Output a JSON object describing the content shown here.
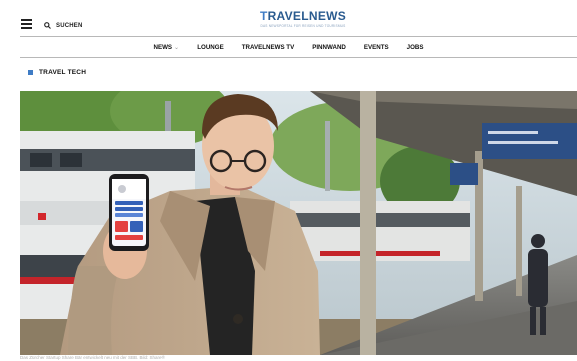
{
  "header": {
    "search_label": "SUCHEN",
    "logo": {
      "name_t": "T",
      "name_rest": "RAVELNEWS",
      "tagline": "DAS NEWSPORTAL FÜR REISEN UND TOURISMUS"
    }
  },
  "nav": {
    "items": [
      {
        "label": "NEWS"
      },
      {
        "label": "LOUNGE"
      },
      {
        "label": "TRAVELNEWS TV"
      },
      {
        "label": "PINNWAND"
      },
      {
        "label": "EVENTS"
      },
      {
        "label": "JOBS"
      }
    ],
    "chevron": "⌄"
  },
  "section": {
    "label": "TRAVEL TECH"
  },
  "article": {
    "caption": "Das Zürcher Startup Share Bär entwickelt neu mit der SBB. Bild: Share®"
  },
  "colors": {
    "accent": "#3f7cc5",
    "logo": "#2a5b8f"
  },
  "icons": [
    "hamburger-icon",
    "search-icon"
  ]
}
